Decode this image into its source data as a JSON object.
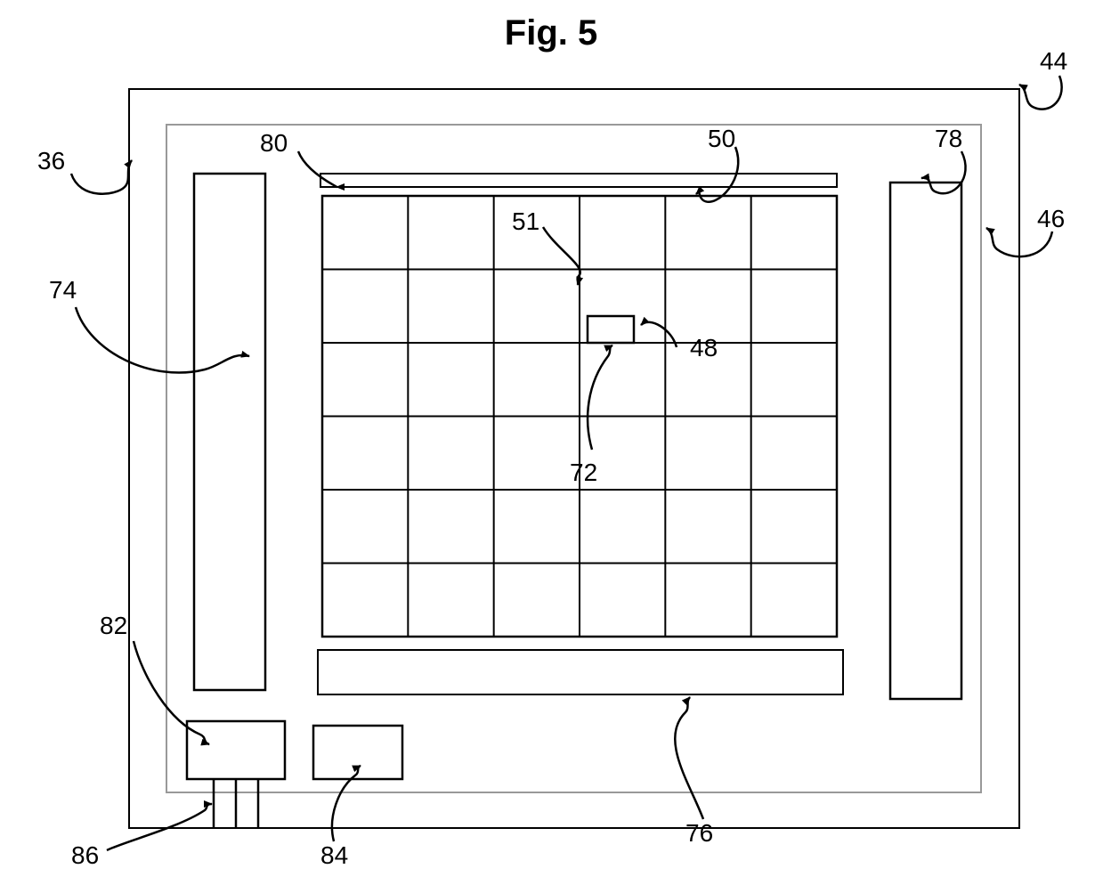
{
  "figure": {
    "title": "Fig. 5",
    "labels": {
      "36": "36",
      "44": "44",
      "46": "46",
      "48": "48",
      "50": "50",
      "51": "51",
      "72": "72",
      "74": "74",
      "76": "76",
      "78": "78",
      "80": "80",
      "82": "82",
      "84": "84",
      "86": "86"
    },
    "grid": {
      "columns": 6,
      "rows": 6
    }
  }
}
